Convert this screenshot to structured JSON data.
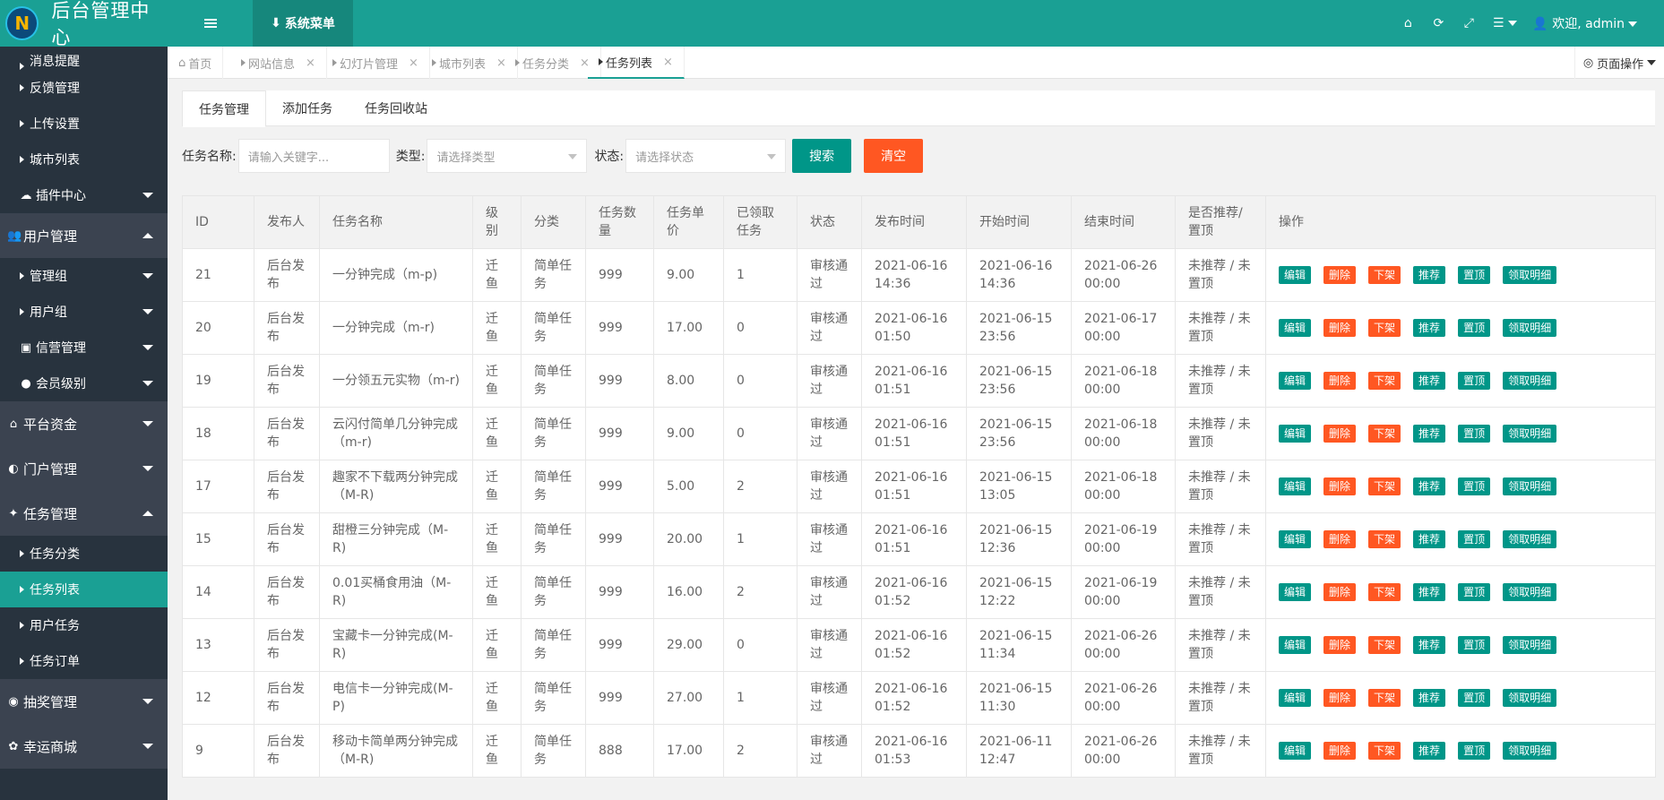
{
  "app": {
    "logo_mark": "N",
    "title": "后台管理中心"
  },
  "colors": {
    "accent": "#1aa094",
    "sidebar": "#28333e",
    "danger": "#ff5722",
    "primary": "#009688"
  },
  "sidebar": {
    "items": [
      {
        "label": "消息提醒",
        "level": "sub",
        "partial": true
      },
      {
        "label": "反馈管理",
        "level": "sub"
      },
      {
        "label": "上传设置",
        "level": "sub"
      },
      {
        "label": "城市列表",
        "level": "sub"
      },
      {
        "label": "插件中心",
        "level": "sub",
        "icon": "☁",
        "icon_name": "cloud-icon",
        "arrow": "down"
      },
      {
        "label": "用户管理",
        "level": "top",
        "icon": "👥",
        "icon_name": "users-icon",
        "arrow": "up"
      },
      {
        "label": "管理组",
        "level": "sub",
        "arrow": "down"
      },
      {
        "label": "用户组",
        "level": "sub",
        "arrow": "down"
      },
      {
        "label": "信营管理",
        "level": "sub",
        "icon": "▣",
        "icon_name": "id-card-icon",
        "arrow": "down"
      },
      {
        "label": "会员级别",
        "level": "sub",
        "icon": "●",
        "icon_name": "user-circle-icon",
        "arrow": "down"
      },
      {
        "label": "平台资金",
        "level": "top",
        "icon": "⌂",
        "icon_name": "bank-icon",
        "arrow": "down"
      },
      {
        "label": "门户管理",
        "level": "top",
        "icon": "◐",
        "icon_name": "portal-icon",
        "arrow": "down"
      },
      {
        "label": "任务管理",
        "level": "top",
        "icon": "✦",
        "icon_name": "tasks-icon",
        "arrow": "up"
      },
      {
        "label": "任务分类",
        "level": "sub"
      },
      {
        "label": "任务列表",
        "level": "sub",
        "active": true
      },
      {
        "label": "用户任务",
        "level": "sub"
      },
      {
        "label": "任务订单",
        "level": "sub"
      },
      {
        "label": "抽奖管理",
        "level": "top",
        "icon": "◉",
        "icon_name": "lottery-icon",
        "arrow": "down"
      },
      {
        "label": "幸运商城",
        "level": "top",
        "icon": "✿",
        "icon_name": "shop-icon",
        "arrow": "down"
      }
    ]
  },
  "header": {
    "system_menu": "系统菜单",
    "welcome": "欢迎, admin"
  },
  "tabs": [
    {
      "label": "首页",
      "home": true
    },
    {
      "label": "网站信息"
    },
    {
      "label": "幻灯片管理"
    },
    {
      "label": "城市列表"
    },
    {
      "label": "任务分类"
    },
    {
      "label": "任务列表",
      "active": true
    }
  ],
  "page_ops": "页面操作",
  "subtabs": [
    "任务管理",
    "添加任务",
    "任务回收站"
  ],
  "search": {
    "name_label": "任务名称:",
    "name_placeholder": "请输入关键字...",
    "type_label": "类型:",
    "type_placeholder": "请选择类型",
    "status_label": "状态:",
    "status_placeholder": "请选择状态",
    "search_btn": "搜索",
    "clear_btn": "清空"
  },
  "table": {
    "headers": [
      "ID",
      "发布人",
      "任务名称",
      "级别",
      "分类",
      "任务数量",
      "任务单价",
      "已领取任务",
      "状态",
      "发布时间",
      "开始时间",
      "结束时间",
      "是否推荐/置顶",
      "操作"
    ],
    "actions": [
      "编辑",
      "删除",
      "下架",
      "推荐",
      "置顶",
      "领取明细"
    ],
    "rows": [
      {
        "id": "21",
        "publisher": "后台发布",
        "name": "一分钟完成（m-p)",
        "level": "迁鱼",
        "cat": "简单任务",
        "qty": "999",
        "price": "9.00",
        "claimed": "1",
        "status": "审核通过",
        "pub": "2021-06-16 14:36",
        "start": "2021-06-16 14:36",
        "end": "2021-06-26 00:00",
        "rec": "未推荐 / 未置顶"
      },
      {
        "id": "20",
        "publisher": "后台发布",
        "name": "一分钟完成（m-r)",
        "level": "迁鱼",
        "cat": "简单任务",
        "qty": "999",
        "price": "17.00",
        "claimed": "0",
        "status": "审核通过",
        "pub": "2021-06-16 01:50",
        "start": "2021-06-15 23:56",
        "end": "2021-06-17 00:00",
        "rec": "未推荐 / 未置顶"
      },
      {
        "id": "19",
        "publisher": "后台发布",
        "name": "一分领五元实物（m-r)",
        "level": "迁鱼",
        "cat": "简单任务",
        "qty": "999",
        "price": "8.00",
        "claimed": "0",
        "status": "审核通过",
        "pub": "2021-06-16 01:51",
        "start": "2021-06-15 23:56",
        "end": "2021-06-18 00:00",
        "rec": "未推荐 / 未置顶"
      },
      {
        "id": "18",
        "publisher": "后台发布",
        "name": "云闪付简单几分钟完成（m-r)",
        "level": "迁鱼",
        "cat": "简单任务",
        "qty": "999",
        "price": "9.00",
        "claimed": "0",
        "status": "审核通过",
        "pub": "2021-06-16 01:51",
        "start": "2021-06-15 23:56",
        "end": "2021-06-18 00:00",
        "rec": "未推荐 / 未置顶"
      },
      {
        "id": "17",
        "publisher": "后台发布",
        "name": "趣家不下载两分钟完成（M-R)",
        "level": "迁鱼",
        "cat": "简单任务",
        "qty": "999",
        "price": "5.00",
        "claimed": "2",
        "status": "审核通过",
        "pub": "2021-06-16 01:51",
        "start": "2021-06-15 13:05",
        "end": "2021-06-18 00:00",
        "rec": "未推荐 / 未置顶"
      },
      {
        "id": "15",
        "publisher": "后台发布",
        "name": "甜橙三分钟完成（M-R)",
        "level": "迁鱼",
        "cat": "简单任务",
        "qty": "999",
        "price": "20.00",
        "claimed": "1",
        "status": "审核通过",
        "pub": "2021-06-16 01:51",
        "start": "2021-06-15 12:36",
        "end": "2021-06-19 00:00",
        "rec": "未推荐 / 未置顶"
      },
      {
        "id": "14",
        "publisher": "后台发布",
        "name": "0.01买桶食用油（M-R)",
        "level": "迁鱼",
        "cat": "简单任务",
        "qty": "999",
        "price": "16.00",
        "claimed": "2",
        "status": "审核通过",
        "pub": "2021-06-16 01:52",
        "start": "2021-06-15 12:22",
        "end": "2021-06-19 00:00",
        "rec": "未推荐 / 未置顶"
      },
      {
        "id": "13",
        "publisher": "后台发布",
        "name": "宝藏卡一分钟完成(M-R)",
        "level": "迁鱼",
        "cat": "简单任务",
        "qty": "999",
        "price": "29.00",
        "claimed": "0",
        "status": "审核通过",
        "pub": "2021-06-16 01:52",
        "start": "2021-06-15 11:34",
        "end": "2021-06-26 00:00",
        "rec": "未推荐 / 未置顶"
      },
      {
        "id": "12",
        "publisher": "后台发布",
        "name": "电信卡一分钟完成(M-P)",
        "level": "迁鱼",
        "cat": "简单任务",
        "qty": "999",
        "price": "27.00",
        "claimed": "1",
        "status": "审核通过",
        "pub": "2021-06-16 01:52",
        "start": "2021-06-15 11:30",
        "end": "2021-06-26 00:00",
        "rec": "未推荐 / 未置顶"
      },
      {
        "id": "9",
        "publisher": "后台发布",
        "name": "移动卡简单两分钟完成（M-R)",
        "level": "迁鱼",
        "cat": "简单任务",
        "qty": "888",
        "price": "17.00",
        "claimed": "2",
        "status": "审核通过",
        "pub": "2021-06-16 01:53",
        "start": "2021-06-11 12:47",
        "end": "2021-06-26 00:00",
        "rec": "未推荐 / 未置顶"
      }
    ]
  }
}
